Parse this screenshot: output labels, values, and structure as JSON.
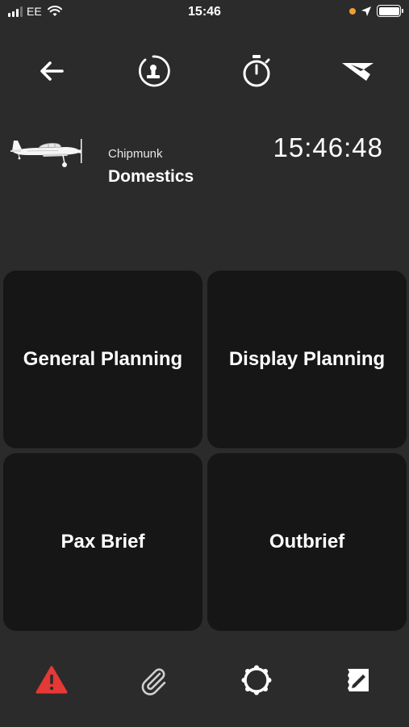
{
  "status_bar": {
    "carrier": "EE",
    "time": "15:46"
  },
  "toolbar": {
    "icons": [
      "back-arrow-icon",
      "stamp-icon",
      "stopwatch-icon",
      "logo-icon"
    ]
  },
  "header": {
    "subtitle": "Chipmunk",
    "title": "Domestics",
    "clock": "15:46:48"
  },
  "tiles": [
    {
      "label": "General Planning"
    },
    {
      "label": "Display Planning"
    },
    {
      "label": "Pax Brief"
    },
    {
      "label": "Outbrief"
    }
  ],
  "bottom_bar": {
    "icons": [
      "warning-icon",
      "paperclip-icon",
      "settings-icon",
      "notes-icon"
    ]
  },
  "colors": {
    "background": "#2b2b2b",
    "tile": "#161616",
    "warning": "#e53935",
    "location_dot": "#f0a030"
  }
}
